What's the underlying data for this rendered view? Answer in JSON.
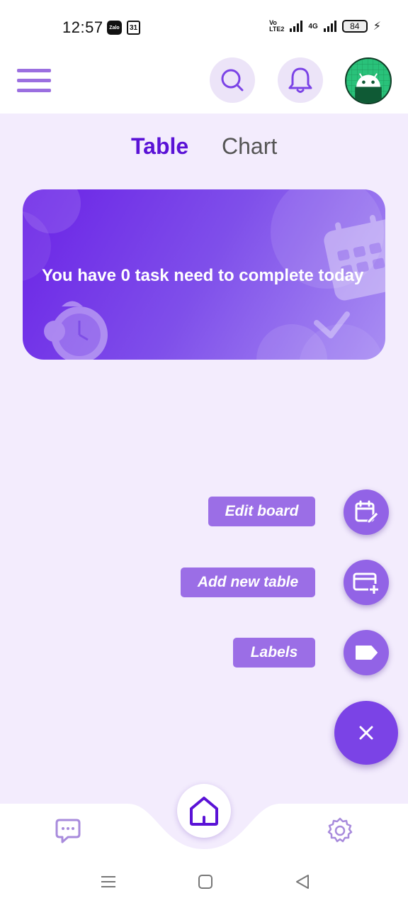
{
  "status_bar": {
    "time": "12:57",
    "zalo_label": "Zalo",
    "calendar_day": "31",
    "volte_top": "Vo",
    "volte_bottom": "LTE2",
    "network": "4G",
    "battery": "84"
  },
  "header": {
    "menu_icon": "hamburger-menu-icon",
    "search_icon": "search-icon",
    "notification_icon": "bell-icon",
    "avatar_icon": "android-avatar-icon"
  },
  "tabs": [
    {
      "label": "Table",
      "active": true
    },
    {
      "label": "Chart",
      "active": false
    }
  ],
  "banner": {
    "text": "You have 0 task need to complete today"
  },
  "fab_menu": {
    "items": [
      {
        "label": "Edit board",
        "icon": "calendar-edit-icon"
      },
      {
        "label": "Add new table",
        "icon": "card-add-icon"
      },
      {
        "label": "Labels",
        "icon": "label-tag-icon"
      }
    ],
    "main_icon": "close-icon"
  },
  "bottom_nav": {
    "items": [
      {
        "name": "chat",
        "icon": "chat-bubble-icon"
      },
      {
        "name": "home",
        "icon": "home-icon",
        "active": true
      },
      {
        "name": "settings",
        "icon": "gear-icon"
      }
    ]
  },
  "colors": {
    "primary": "#5a12d6",
    "accent": "#9263e6",
    "fab": "#7b43e6",
    "background": "#f3ecfd"
  }
}
